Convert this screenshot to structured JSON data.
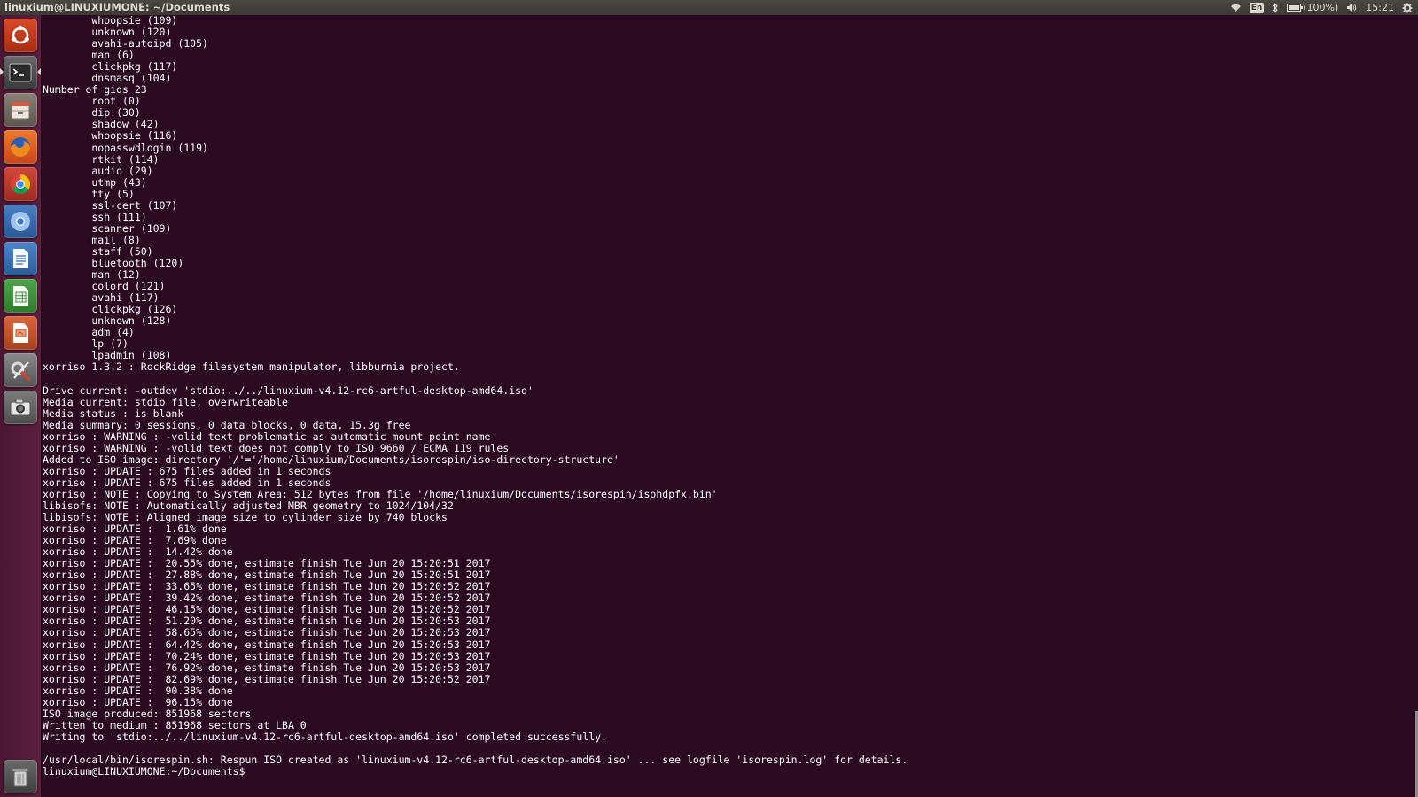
{
  "window": {
    "title": "linuxium@LINUXIUMONE: ~/Documents"
  },
  "top_panel": {
    "keyboard_layout": "En",
    "battery_text": "(100%)",
    "battery_level": 1.0,
    "clock": "15:21",
    "icons": [
      "network-wifi-icon",
      "keyboard-indicator",
      "bluetooth-icon",
      "battery-icon",
      "volume-icon",
      "gear-icon"
    ]
  },
  "launcher": {
    "items": [
      {
        "name": "dash-home",
        "icon": "ubuntu-logo-icon"
      },
      {
        "name": "terminal",
        "icon": "terminal-icon",
        "active": true
      },
      {
        "name": "files",
        "icon": "file-cabinet-icon"
      },
      {
        "name": "firefox",
        "icon": "firefox-icon"
      },
      {
        "name": "chrome",
        "icon": "chrome-icon"
      },
      {
        "name": "chromium",
        "icon": "chromium-icon"
      },
      {
        "name": "libreoffice-writer",
        "icon": "writer-icon"
      },
      {
        "name": "libreoffice-calc",
        "icon": "calc-icon"
      },
      {
        "name": "libreoffice-impress",
        "icon": "impress-icon"
      },
      {
        "name": "system-settings",
        "icon": "settings-tools-icon"
      },
      {
        "name": "screenshot",
        "icon": "camera-icon"
      },
      {
        "name": "trash",
        "icon": "trash-icon"
      }
    ]
  },
  "terminal": {
    "lines": [
      "        whoopsie (109)",
      "        unknown (120)",
      "        avahi-autoipd (105)",
      "        man (6)",
      "        clickpkg (117)",
      "        dnsmasq (104)",
      "Number of gids 23",
      "        root (0)",
      "        dip (30)",
      "        shadow (42)",
      "        whoopsie (116)",
      "        nopasswdlogin (119)",
      "        rtkit (114)",
      "        audio (29)",
      "        utmp (43)",
      "        tty (5)",
      "        ssl-cert (107)",
      "        ssh (111)",
      "        scanner (109)",
      "        mail (8)",
      "        staff (50)",
      "        bluetooth (120)",
      "        man (12)",
      "        colord (121)",
      "        avahi (117)",
      "        clickpkg (126)",
      "        unknown (128)",
      "        adm (4)",
      "        lp (7)",
      "        lpadmin (108)",
      "xorriso 1.3.2 : RockRidge filesystem manipulator, libburnia project.",
      "",
      "Drive current: -outdev 'stdio:../../linuxium-v4.12-rc6-artful-desktop-amd64.iso'",
      "Media current: stdio file, overwriteable",
      "Media status : is blank",
      "Media summary: 0 sessions, 0 data blocks, 0 data, 15.3g free",
      "xorriso : WARNING : -volid text problematic as automatic mount point name",
      "xorriso : WARNING : -volid text does not comply to ISO 9660 / ECMA 119 rules",
      "Added to ISO image: directory '/'='/home/linuxium/Documents/isorespin/iso-directory-structure'",
      "xorriso : UPDATE : 675 files added in 1 seconds",
      "xorriso : UPDATE : 675 files added in 1 seconds",
      "xorriso : NOTE : Copying to System Area: 512 bytes from file '/home/linuxium/Documents/isorespin/isohdpfx.bin'",
      "libisofs: NOTE : Automatically adjusted MBR geometry to 1024/104/32",
      "libisofs: NOTE : Aligned image size to cylinder size by 740 blocks",
      "xorriso : UPDATE :  1.61% done",
      "xorriso : UPDATE :  7.69% done",
      "xorriso : UPDATE :  14.42% done",
      "xorriso : UPDATE :  20.55% done, estimate finish Tue Jun 20 15:20:51 2017",
      "xorriso : UPDATE :  27.88% done, estimate finish Tue Jun 20 15:20:51 2017",
      "xorriso : UPDATE :  33.65% done, estimate finish Tue Jun 20 15:20:52 2017",
      "xorriso : UPDATE :  39.42% done, estimate finish Tue Jun 20 15:20:52 2017",
      "xorriso : UPDATE :  46.15% done, estimate finish Tue Jun 20 15:20:52 2017",
      "xorriso : UPDATE :  51.20% done, estimate finish Tue Jun 20 15:20:53 2017",
      "xorriso : UPDATE :  58.65% done, estimate finish Tue Jun 20 15:20:53 2017",
      "xorriso : UPDATE :  64.42% done, estimate finish Tue Jun 20 15:20:53 2017",
      "xorriso : UPDATE :  70.24% done, estimate finish Tue Jun 20 15:20:53 2017",
      "xorriso : UPDATE :  76.92% done, estimate finish Tue Jun 20 15:20:53 2017",
      "xorriso : UPDATE :  82.69% done, estimate finish Tue Jun 20 15:20:52 2017",
      "xorriso : UPDATE :  90.38% done",
      "xorriso : UPDATE :  96.15% done",
      "ISO image produced: 851968 sectors",
      "Written to medium : 851968 sectors at LBA 0",
      "Writing to 'stdio:../../linuxium-v4.12-rc6-artful-desktop-amd64.iso' completed successfully.",
      "",
      "/usr/local/bin/isorespin.sh: Respun ISO created as 'linuxium-v4.12-rc6-artful-desktop-amd64.iso' ... see logfile 'isorespin.log' for details.",
      "linuxium@LINUXIUMONE:~/Documents$"
    ]
  }
}
